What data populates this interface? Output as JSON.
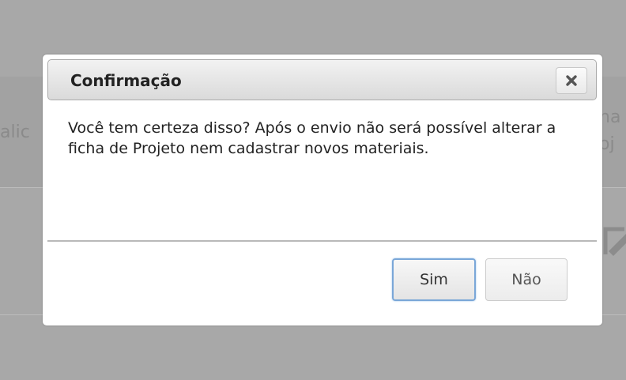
{
  "background": {
    "left_fragment": "alic",
    "right_fragment_1": "ha",
    "right_fragment_2": "oj"
  },
  "dialog": {
    "title": "Confirmação",
    "close_icon": "close-icon",
    "message": "Você tem certeza disso? Após o envio não será possível alterar a ficha de Projeto nem cadastrar novos materiais.",
    "buttons": {
      "yes_label": "Sim",
      "no_label": "Não"
    }
  },
  "colors": {
    "overlay": "#a8a8a8",
    "focus_border": "#7aa7d8"
  }
}
